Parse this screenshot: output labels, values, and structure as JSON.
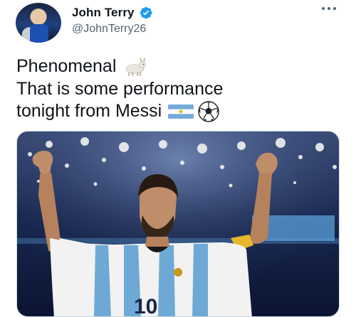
{
  "author": {
    "display_name": "John Terry",
    "handle": "@JohnTerry26",
    "verified": true,
    "avatar": "profile-photo"
  },
  "menu": {
    "icon": "more-icon"
  },
  "tweet": {
    "lines": [
      "Phenomenal",
      "That is some performance",
      "tonight from Messi"
    ],
    "emojis": [
      "goat-emoji",
      "argentina-flag-emoji",
      "soccer-ball-emoji"
    ]
  },
  "media": {
    "type": "photo",
    "subject": "footballer celebrating with raised arms",
    "jersey_number": "10",
    "colors": {
      "stripe_blue": "#74b3e2",
      "stadium": "#1a2a55",
      "armband": "#f2c230"
    }
  },
  "colors": {
    "verified": "#1d9bf0",
    "text": "#0f1419",
    "secondary": "#536471"
  }
}
